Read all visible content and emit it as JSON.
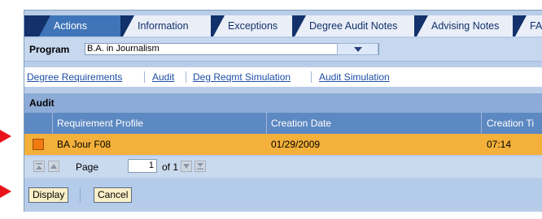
{
  "tabs": [
    {
      "label": "Actions",
      "active": true
    },
    {
      "label": "Information",
      "active": false
    },
    {
      "label": "Exceptions",
      "active": false
    },
    {
      "label": "Degree Audit Notes",
      "active": false
    },
    {
      "label": "Advising Notes",
      "active": false
    },
    {
      "label": "FAQ",
      "active": false
    }
  ],
  "program": {
    "label": "Program",
    "value": "B.A. in Journalism"
  },
  "links": [
    "Degree Requirements",
    "Audit",
    "Deg Reqmt Simulation",
    "Audit Simulation"
  ],
  "audit": {
    "title": "Audit",
    "columns": [
      "Requirement Profile",
      "Creation Date",
      "Creation Ti"
    ],
    "rows": [
      {
        "profile": "BA Jour F08",
        "date": "01/29/2009",
        "time": "07:14"
      }
    ]
  },
  "pager": {
    "page_label": "Page",
    "current": "1",
    "of_label": "of 1"
  },
  "buttons": {
    "display": "Display",
    "cancel": "Cancel"
  },
  "colors": {
    "accent_arrow": "#e8141a",
    "selected_row": "#f3b03a",
    "tab_active": "#3f75b8",
    "tab_bar": "#13316b"
  }
}
